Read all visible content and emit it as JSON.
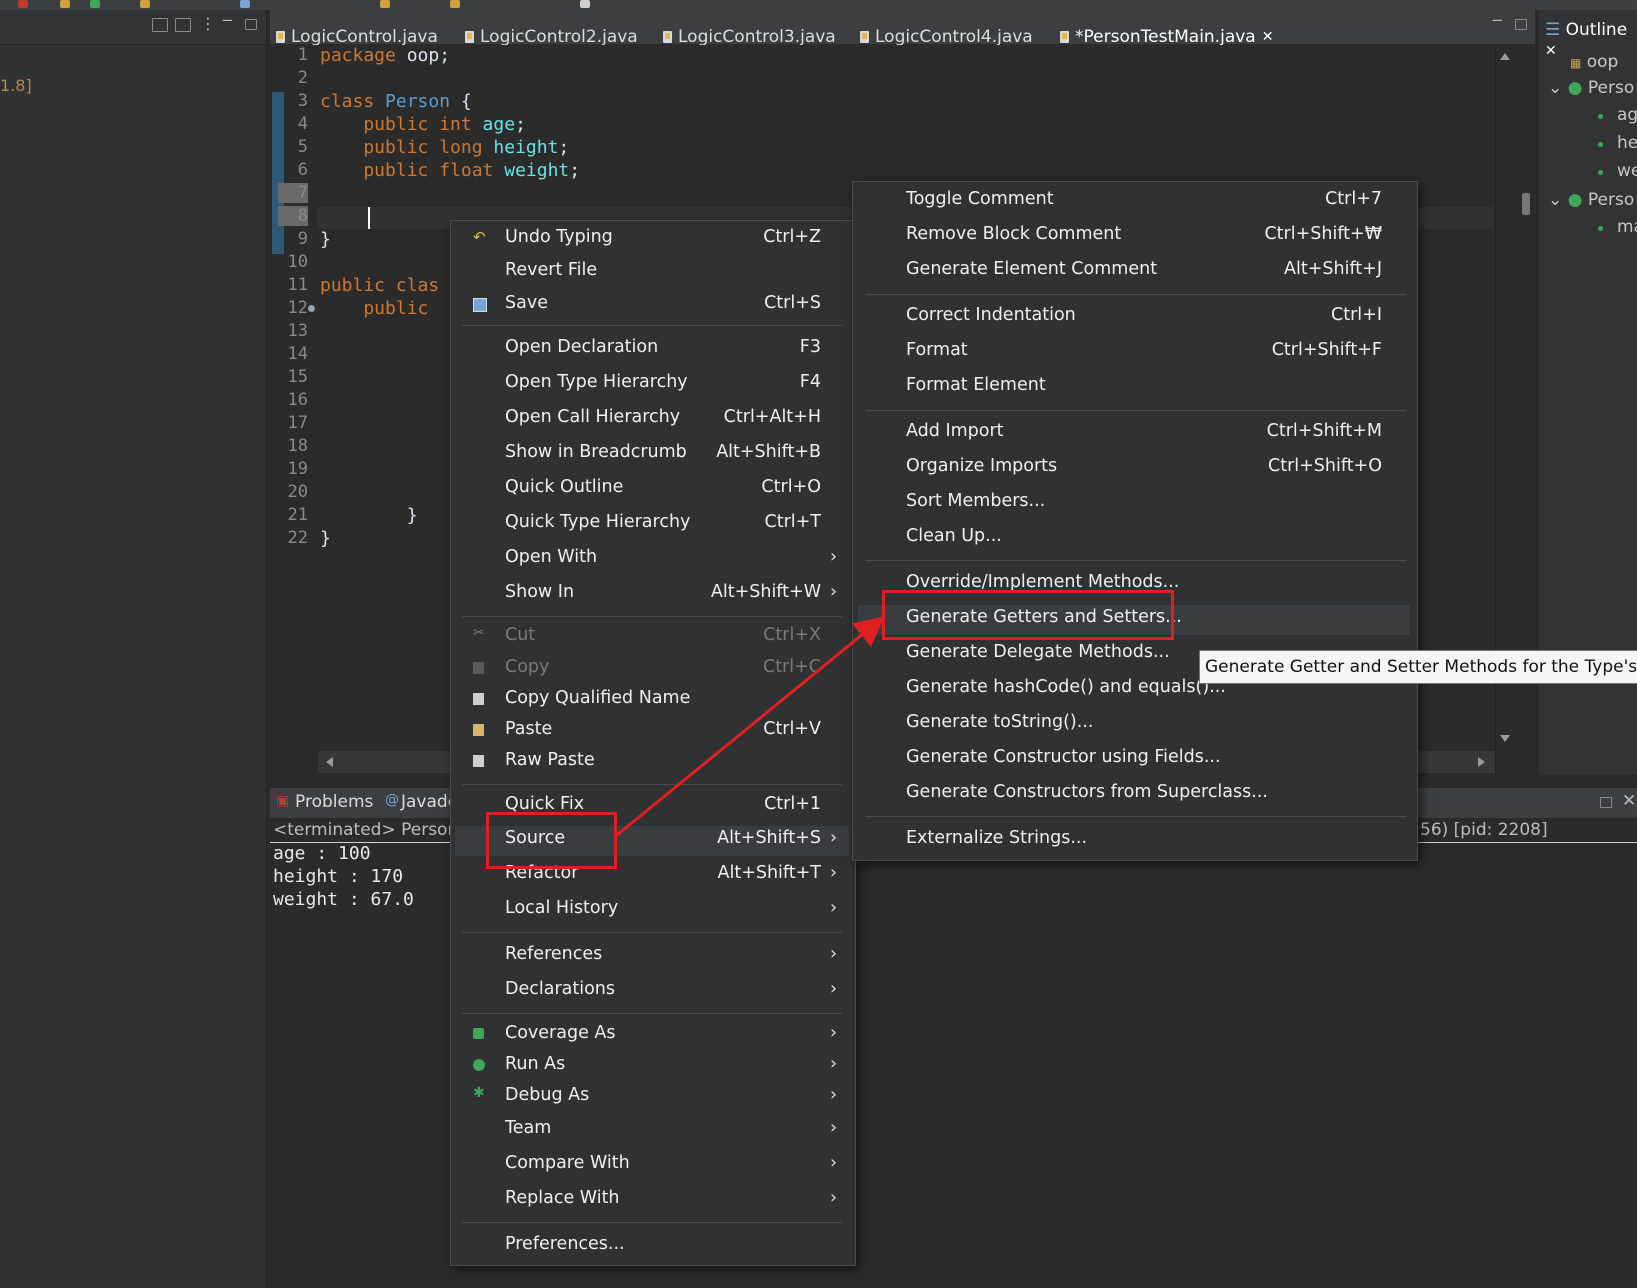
{
  "left_panel": {
    "jre_text": "1.8]"
  },
  "tabs": [
    {
      "label": "LogicControl.java"
    },
    {
      "label": "LogicControl2.java"
    },
    {
      "label": "LogicControl3.java"
    },
    {
      "label": "LogicControl4.java"
    },
    {
      "label": "*PersonTestMain.java",
      "close": "✕"
    }
  ],
  "outline": {
    "title": "Outline",
    "close": "✕",
    "items": [
      "oop",
      "Perso",
      "ag",
      "he",
      "we",
      "Perso",
      "ma"
    ]
  },
  "editor": {
    "line_numbers": [
      "1",
      "2",
      "3",
      "4",
      "5",
      "6",
      "7",
      "8",
      "9",
      "10",
      "11",
      "12",
      "13",
      "14",
      "15",
      "16",
      "17",
      "18",
      "19",
      "20",
      "21",
      "22"
    ],
    "code": {
      "l1_kw": "package",
      "l1_rest": " oop;",
      "l3_kw": "class",
      "l3_type": " Person",
      "l3_rest": " {",
      "l4_kw": "    public int",
      "l4_field": " age",
      "l4_rest": ";",
      "l5_kw": "    public long",
      "l5_field": " height",
      "l5_rest": ";",
      "l6_kw": "    public float",
      "l6_field": " weight",
      "l6_rest": ";",
      "l9": "}",
      "l11_kw": "public clas",
      "l12_kw": "    public",
      "l21": "        }",
      "l22": "}"
    }
  },
  "console": {
    "tabs": [
      "Problems",
      "Javadc"
    ],
    "header": "<terminated> Person",
    "header_right": "56) [pid: 2208]",
    "lines": [
      "age : 100",
      "height : 170",
      "weight : 67.0"
    ]
  },
  "context_menu": {
    "items": [
      {
        "label": "Undo Typing",
        "shortcut": "Ctrl+Z"
      },
      {
        "label": "Revert File",
        "shortcut": ""
      },
      {
        "label": "Save",
        "shortcut": "Ctrl+S"
      },
      {
        "label": "Open Declaration",
        "shortcut": "F3"
      },
      {
        "label": "Open Type Hierarchy",
        "shortcut": "F4"
      },
      {
        "label": "Open Call Hierarchy",
        "shortcut": "Ctrl+Alt+H"
      },
      {
        "label": "Show in Breadcrumb",
        "shortcut": "Alt+Shift+B"
      },
      {
        "label": "Quick Outline",
        "shortcut": "Ctrl+O"
      },
      {
        "label": "Quick Type Hierarchy",
        "shortcut": "Ctrl+T"
      },
      {
        "label": "Open With",
        "shortcut": ""
      },
      {
        "label": "Show In",
        "shortcut": "Alt+Shift+W"
      },
      {
        "label": "Cut",
        "shortcut": "Ctrl+X"
      },
      {
        "label": "Copy",
        "shortcut": "Ctrl+C"
      },
      {
        "label": "Copy Qualified Name",
        "shortcut": ""
      },
      {
        "label": "Paste",
        "shortcut": "Ctrl+V"
      },
      {
        "label": "Raw Paste",
        "shortcut": ""
      },
      {
        "label": "Quick Fix",
        "shortcut": "Ctrl+1"
      },
      {
        "label": "Source",
        "shortcut": "Alt+Shift+S"
      },
      {
        "label": "Refactor",
        "shortcut": "Alt+Shift+T"
      },
      {
        "label": "Local History",
        "shortcut": ""
      },
      {
        "label": "References",
        "shortcut": ""
      },
      {
        "label": "Declarations",
        "shortcut": ""
      },
      {
        "label": "Coverage As",
        "shortcut": ""
      },
      {
        "label": "Run As",
        "shortcut": ""
      },
      {
        "label": "Debug As",
        "shortcut": ""
      },
      {
        "label": "Team",
        "shortcut": ""
      },
      {
        "label": "Compare With",
        "shortcut": ""
      },
      {
        "label": "Replace With",
        "shortcut": ""
      },
      {
        "label": "Preferences...",
        "shortcut": ""
      }
    ],
    "arrow": "›"
  },
  "source_submenu": {
    "items": [
      {
        "label": "Toggle Comment",
        "shortcut": "Ctrl+7"
      },
      {
        "label": "Remove Block Comment",
        "shortcut": "Ctrl+Shift+₩"
      },
      {
        "label": "Generate Element Comment",
        "shortcut": "Alt+Shift+J"
      },
      {
        "label": "Correct Indentation",
        "shortcut": "Ctrl+I"
      },
      {
        "label": "Format",
        "shortcut": "Ctrl+Shift+F"
      },
      {
        "label": "Format Element",
        "shortcut": ""
      },
      {
        "label": "Add Import",
        "shortcut": "Ctrl+Shift+M"
      },
      {
        "label": "Organize Imports",
        "shortcut": "Ctrl+Shift+O"
      },
      {
        "label": "Sort Members...",
        "shortcut": ""
      },
      {
        "label": "Clean Up...",
        "shortcut": ""
      },
      {
        "label": "Override/Implement Methods...",
        "shortcut": ""
      },
      {
        "label": "Generate Getters and Setters...",
        "shortcut": ""
      },
      {
        "label": "Generate Delegate Methods...",
        "shortcut": ""
      },
      {
        "label": "Generate hashCode() and equals()...",
        "shortcut": ""
      },
      {
        "label": "Generate toString()...",
        "shortcut": ""
      },
      {
        "label": "Generate Constructor using Fields...",
        "shortcut": ""
      },
      {
        "label": "Generate Constructors from Superclass...",
        "shortcut": ""
      },
      {
        "label": "Externalize Strings...",
        "shortcut": ""
      }
    ]
  },
  "tooltip": {
    "text": "Generate Getter and Setter Methods for the Type's F"
  },
  "colors": {
    "annotation_red": "#e02020",
    "keyword": "#cc7832",
    "type": "#5e9bd1",
    "field": "#66e3e3"
  }
}
